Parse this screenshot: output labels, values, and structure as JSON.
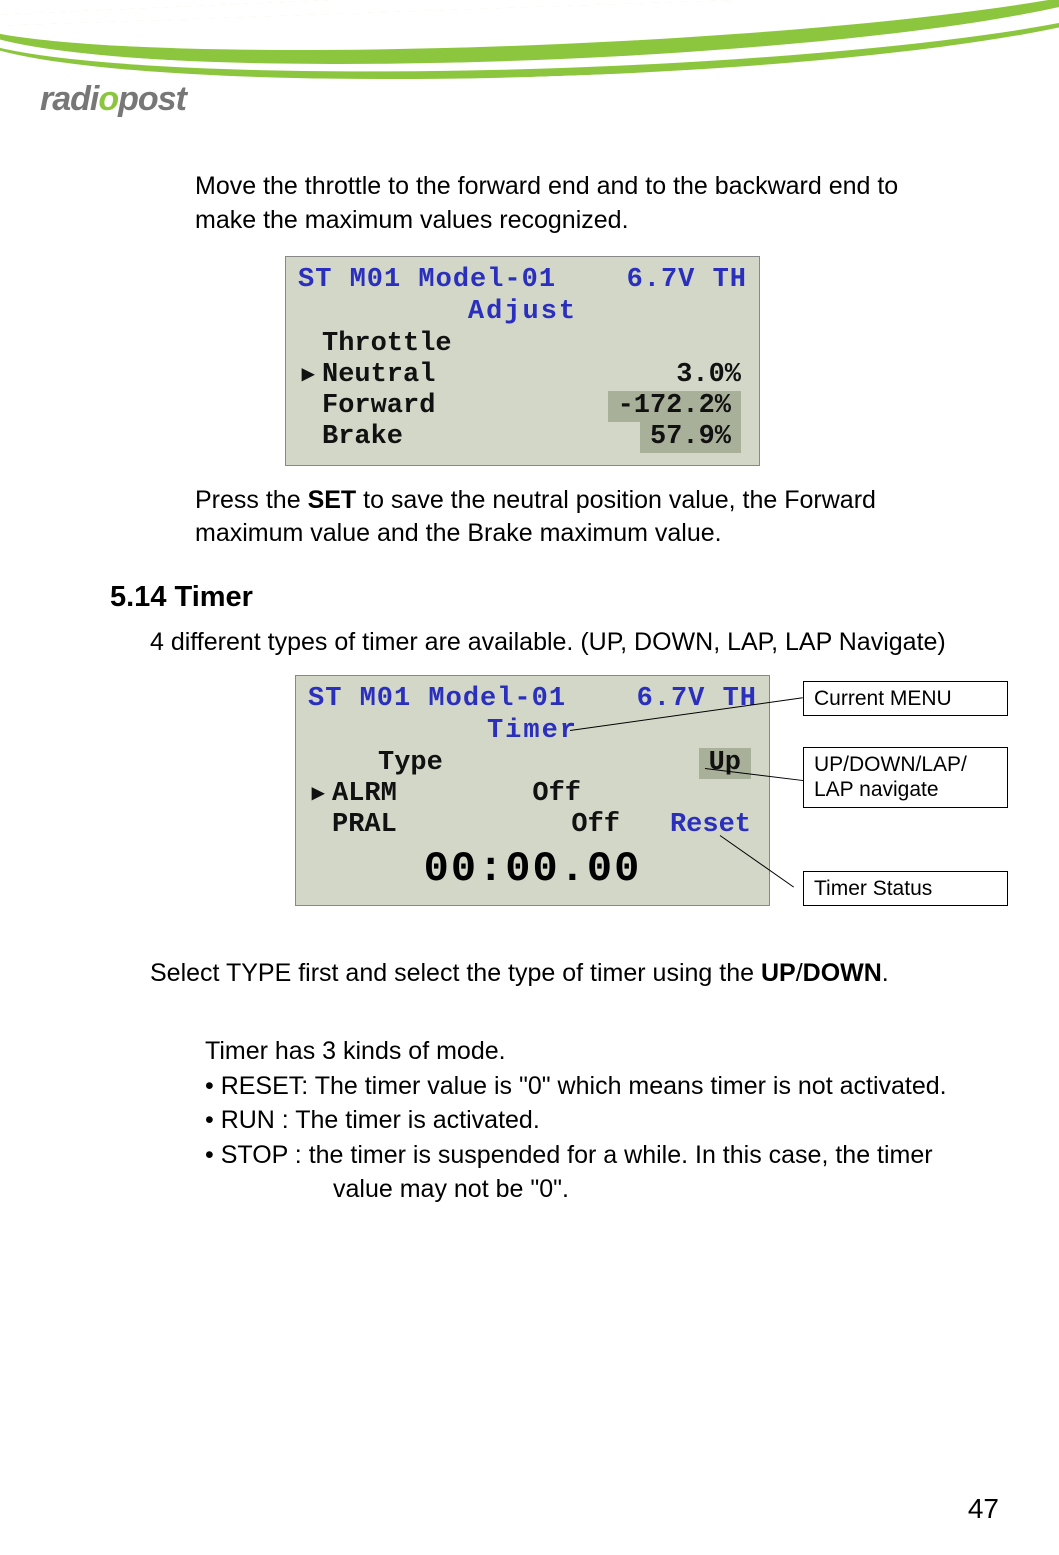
{
  "header": {
    "logo_text": "radiopost"
  },
  "para1": "Move the throttle to the forward end and to the backward end to make the maximum values recognized.",
  "lcd1": {
    "st": "ST",
    "model": "M01 Model-01",
    "volt": "6.7V",
    "th": "TH",
    "title": "Adjust",
    "rows": [
      {
        "label": "Throttle",
        "value": ""
      },
      {
        "label": "Neutral",
        "value": "3.0%"
      },
      {
        "label": "Forward",
        "value": "-172.2%"
      },
      {
        "label": "Brake",
        "value": "57.9%"
      }
    ]
  },
  "para2a": "Press the ",
  "para2b": "SET",
  "para2c": " to save the neutral position value, the Forward maximum value and the Brake maximum value.",
  "section_heading": "5.14 Timer",
  "para3": "4 different types of timer are available. (UP, DOWN, LAP, LAP Navigate)",
  "lcd2": {
    "st": "ST",
    "model": "M01 Model-01",
    "volt": "6.7V",
    "th": "TH",
    "title": "Timer",
    "type_label": "Type",
    "type_value": "Up",
    "alrm_label": "ALRM",
    "alrm_value": "Off",
    "pral_label": "PRAL",
    "pral_value": "Off",
    "reset": "Reset",
    "time": "00:00.00"
  },
  "callouts": {
    "current_menu": "Current MENU",
    "types": "UP/DOWN/LAP/\nLAP navigate",
    "timer_status": "Timer Status"
  },
  "para4a": "Select TYPE first and select the type of timer using the ",
  "para4b": "UP",
  "para4c": "/",
  "para4d": "DOWN",
  "para4e": ".",
  "modes_intro": "Timer has 3 kinds of mode.",
  "modes": {
    "reset": "• RESET: The timer value is \"0\" which means timer is not activated.",
    "run": "• RUN  : The timer is activated.",
    "stop1": "• STOP : the timer is suspended for a while.  In this case, the timer",
    "stop2": "value may not be \"0\"."
  },
  "page_number": "47"
}
